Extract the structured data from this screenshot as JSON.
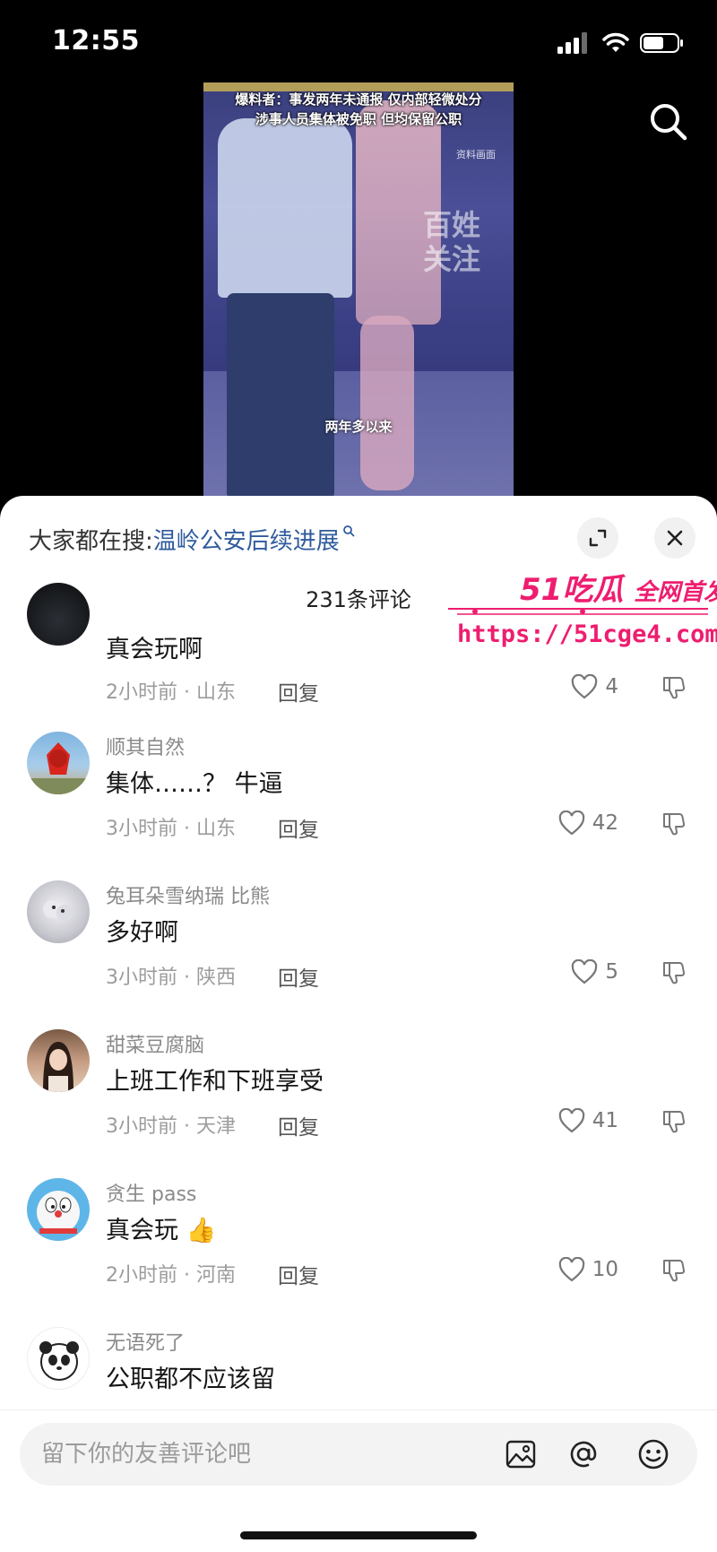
{
  "status_bar": {
    "time": "12:55"
  },
  "video": {
    "headline_line1": "爆料者：事发两年未通报 仅内部轻微处分",
    "headline_line2": "涉事人员集体被免职 但均保留公职",
    "source_tag": "资料画面",
    "watermark": "百姓关注",
    "subtitle": "两年多以来"
  },
  "sheet": {
    "hot_search_prefix": "大家都在搜:",
    "hot_search_term": "温岭公安后续进展",
    "comment_count": "231条评论"
  },
  "promo": {
    "brand": "51吃瓜",
    "slogan": "全网首发",
    "url": "https://51cge4.com"
  },
  "comments": [
    {
      "user": "",
      "text": "真会玩啊",
      "time": "2小时前",
      "location": "山东",
      "reply": "回复",
      "likes": "4",
      "avatar": "dark"
    },
    {
      "user": "顺其自然",
      "text": "集体……？ 牛逼",
      "time": "3小时前",
      "location": "山东",
      "reply": "回复",
      "likes": "42",
      "avatar": "red-sculpture"
    },
    {
      "user": "兔耳朵雪纳瑞 比熊",
      "text": "多好啊",
      "time": "3小时前",
      "location": "陕西",
      "reply": "回复",
      "likes": "5",
      "avatar": "white-dog"
    },
    {
      "user": "甜菜豆腐脑",
      "text": "上班工作和下班享受",
      "time": "3小时前",
      "location": "天津",
      "reply": "回复",
      "likes": "41",
      "avatar": "girl"
    },
    {
      "user": "贪生 pass",
      "text": "真会玩",
      "emoji": "👍",
      "time": "2小时前",
      "location": "河南",
      "reply": "回复",
      "likes": "10",
      "avatar": "doraemon"
    },
    {
      "user": "无语死了",
      "text": "公职都不应该留",
      "time": "",
      "location": "",
      "reply": "",
      "likes": "",
      "avatar": "panda"
    }
  ],
  "input_bar": {
    "placeholder": "留下你的友善评论吧"
  },
  "icons": {
    "search": "search-icon",
    "expand": "expand-icon",
    "close": "close-icon",
    "like": "heart-icon",
    "dislike": "thumbs-down-icon",
    "image": "image-icon",
    "mention": "at-icon",
    "emoji": "emoji-icon"
  },
  "colors": {
    "hot_search_link": "#2f5b9c",
    "promo": "#ee1d6f"
  }
}
